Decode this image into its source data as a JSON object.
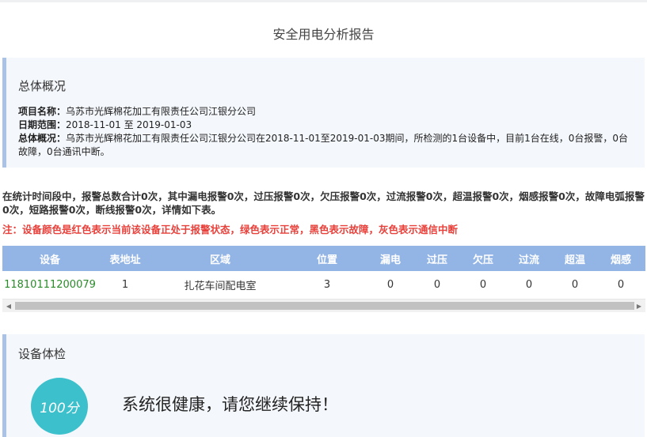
{
  "report_title": "安全用电分析报告",
  "overview": {
    "title": "总体概况",
    "project_label": "项目名称：",
    "project_value": "乌苏市光辉棉花加工有限责任公司江银分公司",
    "date_label": "日期范围：",
    "date_value": "2018-11-01 至 2019-01-03",
    "summary_label": "总体概况：",
    "summary_value": "乌苏市光辉棉花加工有限责任公司江银分公司在2018-11-01至2019-01-03期间，所检测的1台设备中，目前1台在线，0台报警，0台故障，0台通讯中断。"
  },
  "stats_text": "在统计时间段中，报警总数合计0次，其中漏电报警0次，过压报警0次，欠压报警0次，过流报警0次，超温报警0次，烟感报警0次，故障电弧报警0次，短路报警0次，断线报警0次，详情如下表。",
  "note_text": "注：设备颜色是红色表示当前该设备正处于报警状态，绿色表示正常，黑色表示故障，灰色表示通信中断",
  "table": {
    "headers": [
      "设备",
      "表地址",
      "区域",
      "位置",
      "漏电",
      "过压",
      "欠压",
      "过流",
      "超温",
      "烟感"
    ],
    "row": [
      "11810111200079",
      "1",
      "扎花车间配电室",
      "3",
      "0",
      "0",
      "0",
      "0",
      "0",
      "0"
    ]
  },
  "health": {
    "title": "设备体检",
    "score": "100分",
    "message": "系统很健康，请您继续保持！"
  },
  "colors": {
    "accent_border": "#a9c2e6",
    "table_header": "#93b5e6",
    "device_ok": "#2a8a2a",
    "note_red": "#e8413b",
    "score_circle": "#3cc0cc"
  }
}
